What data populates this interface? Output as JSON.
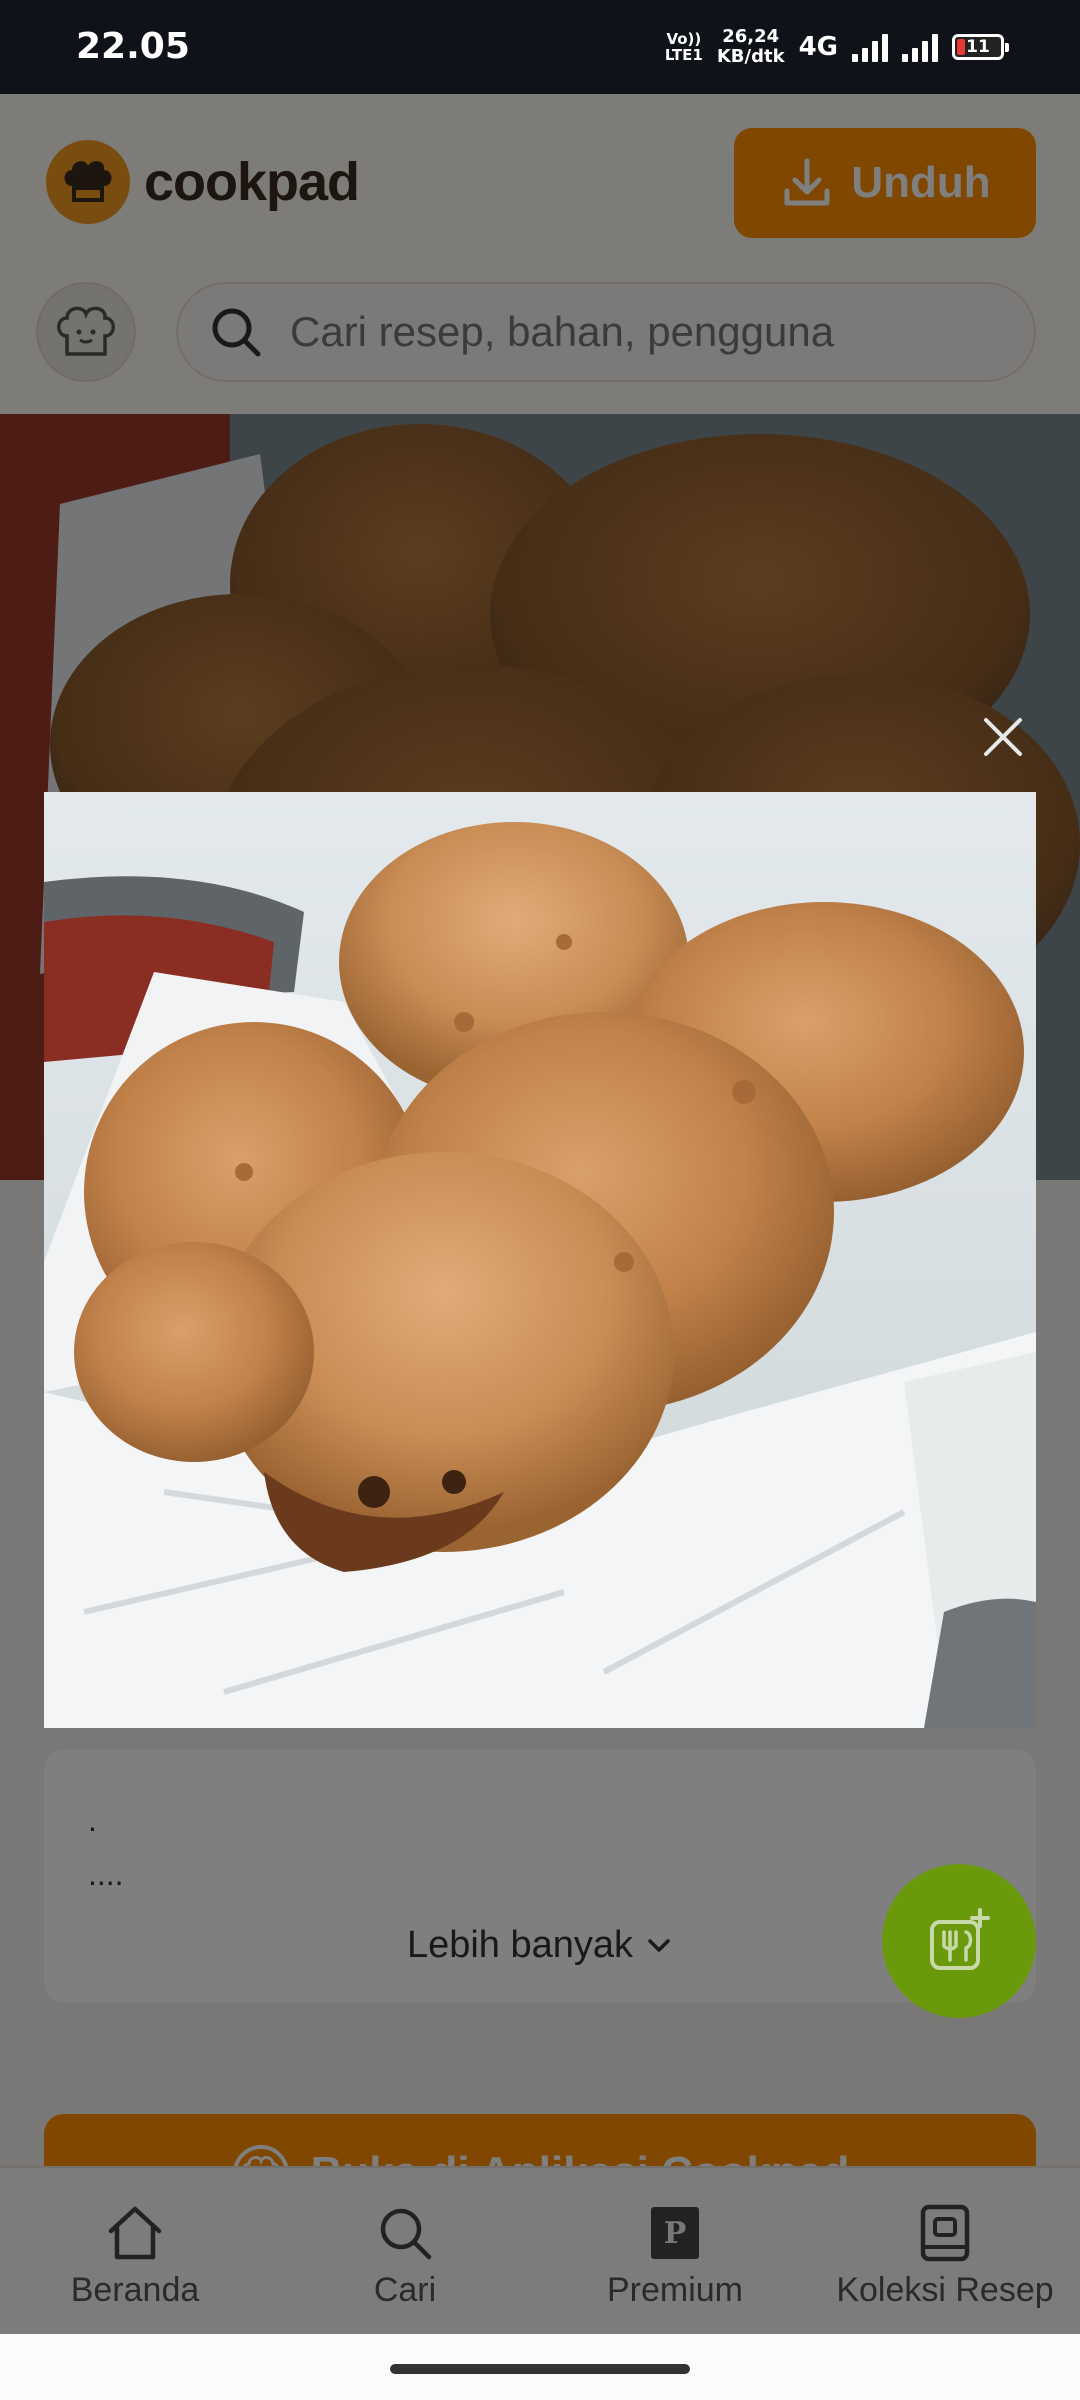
{
  "status_bar": {
    "time": "22.05",
    "volte_top": "Vo))",
    "volte_bottom": "LTE1",
    "speed_value": "26,24",
    "speed_unit": "KB/dtk",
    "network": "4G",
    "battery": "11"
  },
  "header": {
    "logo_text": "cookpad",
    "download_label": "Unduh"
  },
  "search": {
    "placeholder": "Cari resep, bahan, pengguna"
  },
  "recipe_card": {
    "line1": ".",
    "line2": "....",
    "more_label": "Lebih banyak"
  },
  "open_app_label": "Buka di Aplikasi Cookpad",
  "bottom_nav": [
    {
      "label": "Beranda",
      "icon": "home-icon"
    },
    {
      "label": "Cari",
      "icon": "search-icon"
    },
    {
      "label": "Premium",
      "icon": "premium-icon"
    },
    {
      "label": "Koleksi Resep",
      "icon": "collection-icon"
    }
  ],
  "colors": {
    "brand_orange": "#ff8f00",
    "fab_green": "#6a9a0c",
    "status_bar": "#0f1218"
  }
}
